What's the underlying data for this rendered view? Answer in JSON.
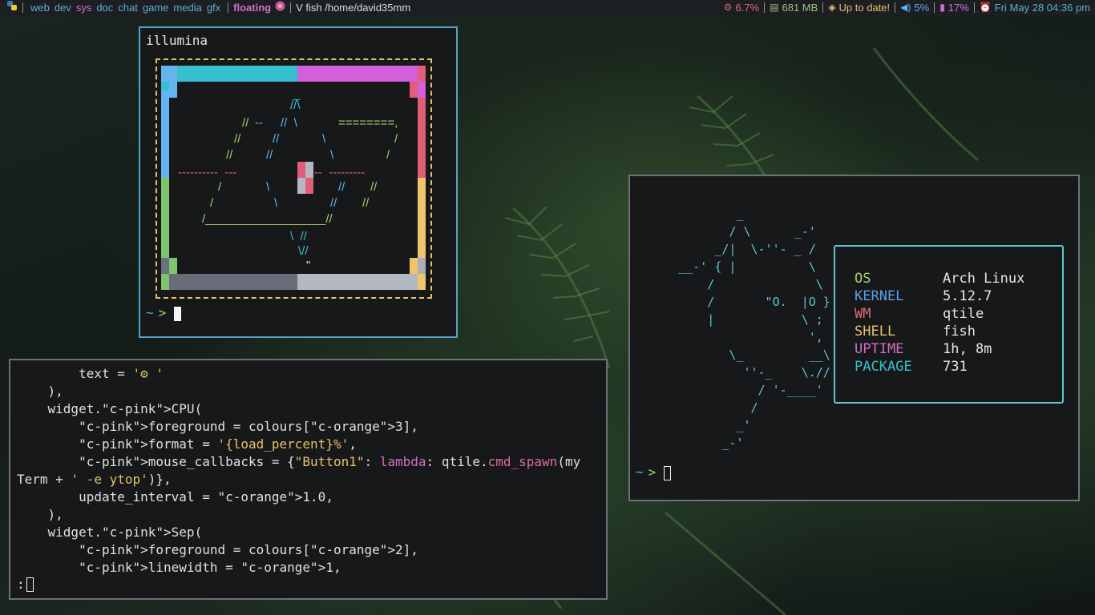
{
  "bar": {
    "launcher_icon": "python-icon",
    "workspaces": [
      "web",
      "dev",
      "sys",
      "doc",
      "chat",
      "game",
      "media",
      "gfx"
    ],
    "active_workspace": "sys",
    "layout": "floating",
    "window_title": "V fish /home/david35mm",
    "cpu": "6.7%",
    "memory": "681 MB",
    "updates": "Up to date!",
    "volume": "5%",
    "battery": "17%",
    "clock": "Fri May 28  04:36 pm",
    "colors": {
      "cpu": "#e06c75",
      "memory": "#98c379",
      "updates": "#e5c07b",
      "volume": "#61afef",
      "battery": "#c678dd",
      "clock": "#56b6c2"
    }
  },
  "illumina": {
    "title": "illumina",
    "prompt_tilde": "~",
    "prompt_arrow": ">"
  },
  "editor": {
    "lines": [
      "        text = '⚙ '",
      "    ),",
      "    widget.CPU(",
      "        foreground = colours[3],",
      "        format = '{load_percent}%',",
      "        mouse_callbacks = {\"Button1\": lambda: qtile.cmd_spawn(my",
      "Term + ' -e ytop')},",
      "        update_interval = 1.0,",
      "    ),",
      "    widget.Sep(",
      "        foreground = colours[2],",
      "        linewidth = 1,"
    ],
    "cmdline": ":"
  },
  "fetch": {
    "prompt_tilde": "~",
    "prompt_arrow": ">",
    "rows": [
      {
        "key": "OS",
        "value": "Arch Linux",
        "color": "#a5d16f"
      },
      {
        "key": "KERNEL",
        "value": "5.12.7",
        "color": "#5aa0e8"
      },
      {
        "key": "WM",
        "value": "qtile",
        "color": "#e06c75"
      },
      {
        "key": "SHELL",
        "value": "fish",
        "color": "#e8c26a"
      },
      {
        "key": "UPTIME",
        "value": "1h, 8m",
        "color": "#d46fc5"
      },
      {
        "key": "PACKAGE",
        "value": "731",
        "color": "#36c2c9"
      }
    ]
  }
}
